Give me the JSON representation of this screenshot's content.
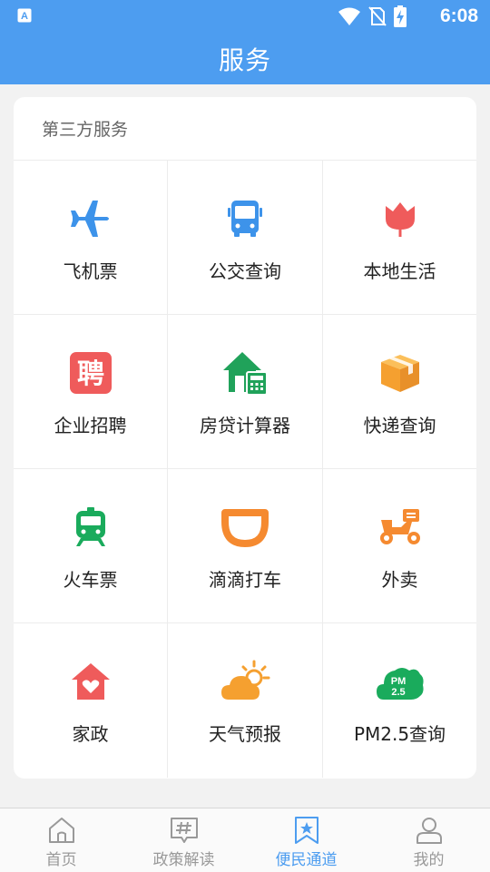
{
  "status_bar": {
    "time": "6:08",
    "icons": [
      "app-notification-icon",
      "wifi-icon",
      "no-sim-icon",
      "battery-charging-icon"
    ]
  },
  "app_bar": {
    "title": "服务"
  },
  "section": {
    "title": "第三方服务",
    "items": [
      {
        "label": "飞机票",
        "icon": "airplane-icon",
        "color": "#3d93ea"
      },
      {
        "label": "公交查询",
        "icon": "bus-icon",
        "color": "#3d93ea"
      },
      {
        "label": "本地生活",
        "icon": "tulip-icon",
        "color": "#ef5b5b"
      },
      {
        "label": "企业招聘",
        "icon": "recruit-icon",
        "color": "#ef5b5b"
      },
      {
        "label": "房贷计算器",
        "icon": "house-calculator-icon",
        "color": "#20a25a"
      },
      {
        "label": "快递查询",
        "icon": "package-icon",
        "color": "#f5a030"
      },
      {
        "label": "火车票",
        "icon": "train-icon",
        "color": "#1aab5c"
      },
      {
        "label": "滴滴打车",
        "icon": "didi-icon",
        "color": "#f58a30"
      },
      {
        "label": "外卖",
        "icon": "scooter-icon",
        "color": "#f58a30"
      },
      {
        "label": "家政",
        "icon": "home-heart-icon",
        "color": "#ef5b5b"
      },
      {
        "label": "天气预报",
        "icon": "weather-icon",
        "color": "#f5a030"
      },
      {
        "label": "PM2.5查询",
        "icon": "pm25-cloud-icon",
        "color": "#1aab5c"
      }
    ]
  },
  "bottom_nav": {
    "items": [
      {
        "label": "首页",
        "icon": "home-icon",
        "active": false
      },
      {
        "label": "政策解读",
        "icon": "policy-chat-icon",
        "active": false
      },
      {
        "label": "便民通道",
        "icon": "bookmark-star-icon",
        "active": true
      },
      {
        "label": "我的",
        "icon": "user-icon",
        "active": false
      }
    ],
    "active_color": "#4d9df0",
    "inactive_color": "#999999"
  }
}
